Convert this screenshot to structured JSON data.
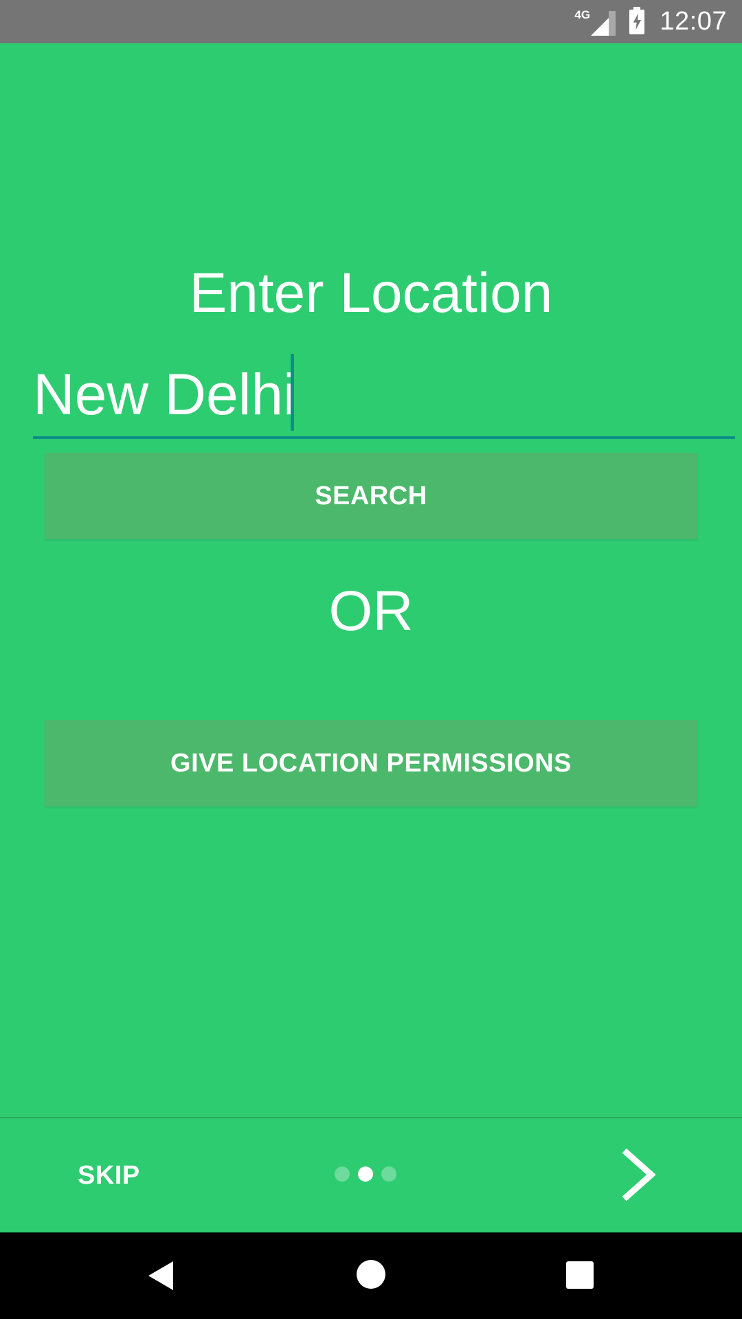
{
  "status_bar": {
    "network": "4G",
    "time": "12:07"
  },
  "screen": {
    "title": "Enter Location",
    "location_input_value": "New Delhi",
    "search_button_label": "SEARCH",
    "or_label": "OR",
    "permissions_button_label": "GIVE LOCATION PERMISSIONS"
  },
  "onboarding": {
    "skip_label": "SKIP",
    "page_count": 3,
    "current_page": 2,
    "next_icon": "chevron-right-icon"
  },
  "colors": {
    "background": "#2ECC71",
    "button": "#4CB86B",
    "input_accent": "#0C8F86",
    "status_bar": "#757575",
    "nav_bar": "#000000"
  }
}
